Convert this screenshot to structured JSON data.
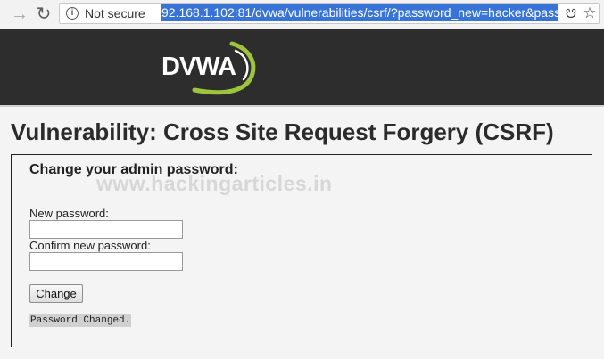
{
  "browser": {
    "security_label": "Not secure",
    "url": "92.168.1.102:81/dvwa/vulnerabilities/csrf/?password_new=hacker&pass"
  },
  "header": {
    "logo_text": "DVWA",
    "logo_swoosh_color": "#9dc53b"
  },
  "main": {
    "title": "Vulnerability: Cross Site Request Forgery (CSRF)",
    "form": {
      "heading": "Change your admin password:",
      "new_password_label": "New password:",
      "new_password_value": "",
      "confirm_password_label": "Confirm new password:",
      "confirm_password_value": "",
      "submit_label": "Change",
      "status_message": "Password Changed."
    },
    "watermark": "www.hackingarticles.in"
  }
}
